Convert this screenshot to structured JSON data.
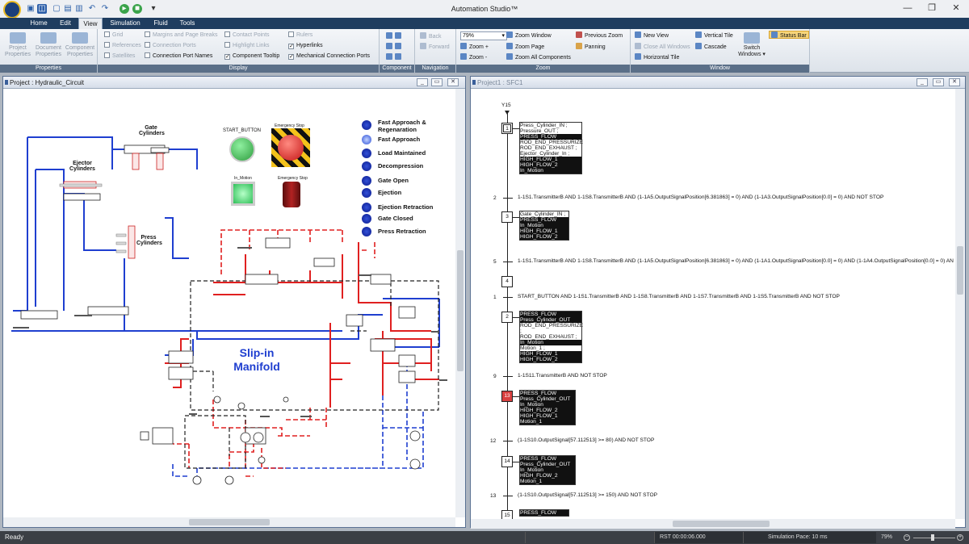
{
  "app": {
    "title": "Automation Studio™"
  },
  "qat": {
    "save_icon": "save-icon",
    "undo_icon": "undo-icon",
    "redo_icon": "redo-icon",
    "run_icon": "run-icon",
    "stop_icon": "stop-icon",
    "more": "▾"
  },
  "window_controls": {
    "minimize": "—",
    "restore": "❐",
    "close": "✕"
  },
  "tabs": [
    {
      "label": "Home"
    },
    {
      "label": "Edit"
    },
    {
      "label": "View"
    },
    {
      "label": "Simulation"
    },
    {
      "label": "Fluid"
    },
    {
      "label": "Tools"
    }
  ],
  "ribbon": {
    "properties": {
      "label": "Properties",
      "buttons": [
        {
          "label": "Project Properties"
        },
        {
          "label": "Document Properties"
        },
        {
          "label": "Component Properties"
        }
      ]
    },
    "display": {
      "label": "Display",
      "col1": [
        {
          "label": "Grid",
          "checked": false,
          "enabled": false
        },
        {
          "label": "References",
          "checked": false,
          "enabled": false
        },
        {
          "label": "Satellites",
          "checked": false,
          "enabled": false
        }
      ],
      "col2": [
        {
          "label": "Margins and Page Breaks",
          "checked": false,
          "enabled": false
        },
        {
          "label": "Connection Ports",
          "checked": false,
          "enabled": false
        },
        {
          "label": "Connection Port Names",
          "checked": false,
          "enabled": true
        }
      ],
      "col3": [
        {
          "label": "Contact Points",
          "checked": false,
          "enabled": false
        },
        {
          "label": "Highlight Links",
          "checked": false,
          "enabled": false
        },
        {
          "label": "Component Tooltip",
          "checked": true,
          "enabled": true
        }
      ],
      "col4": [
        {
          "label": "Rulers",
          "checked": false,
          "enabled": false
        },
        {
          "label": "Hyperlinks",
          "checked": true,
          "enabled": true
        },
        {
          "label": "Mechanical Connection Ports",
          "checked": true,
          "enabled": true
        }
      ]
    },
    "component": {
      "label": "Component"
    },
    "navigation": {
      "label": "Navigation",
      "back": "Back",
      "forward": "Forward"
    },
    "zoom": {
      "label": "Zoom",
      "value": "79%",
      "zoom_in": "Zoom +",
      "zoom_out": "Zoom -",
      "zoom_window": "Zoom Window",
      "zoom_page": "Zoom Page",
      "zoom_all": "Zoom All Components",
      "previous_zoom": "Previous Zoom",
      "panning": "Panning"
    },
    "window": {
      "label": "Window",
      "new_view": "New View",
      "close_all": "Close All Windows",
      "horizontal_tile": "Horizontal Tile",
      "vertical_tile": "Vertical Tile",
      "cascade": "Cascade",
      "switch_windows": "Switch Windows",
      "status_bar": "Status Bar"
    }
  },
  "left_window": {
    "title": "Project : Hydraulic_Circuit",
    "labels": {
      "gate_cylinders": "Gate Cylinders",
      "ejector_cylinders": "Ejector Cylinders",
      "press_cylinders": "Press Cylinders",
      "start_button": "START_BUTTON",
      "emergency_stop_small": "Emergency Stop",
      "in_motion": "In_Motion",
      "emergency_stop": "Emergency Stop",
      "slip_in_manifold": "Slip-in Manifold"
    },
    "indicators": [
      {
        "label": "Fast Approach & Regenaration"
      },
      {
        "label": "Fast Approach"
      },
      {
        "label": "Load Maintained"
      },
      {
        "label": "Decompression"
      },
      {
        "label": "Gate Open"
      },
      {
        "label": "Ejection"
      },
      {
        "label": "Ejection Retraction"
      },
      {
        "label": "Gate Closed"
      },
      {
        "label": "Press Retraction"
      }
    ]
  },
  "right_window": {
    "title": "Project1 : SFC1",
    "initial_label": "Y15",
    "steps": [
      {
        "num": "1",
        "actions": [
          {
            "text": "Press_Cylinder_IN ;",
            "dark": false
          },
          {
            "text": "Pressure_OUT ;",
            "dark": false
          },
          {
            "text": "PRESS_FLOW",
            "dark": true
          },
          {
            "text": "ROD_END_PRESSURIZE",
            "dark": false
          },
          {
            "text": "ROD_END_EXHAUST ;",
            "dark": false
          },
          {
            "text": "Ejector_Cylinder_In ;",
            "dark": false
          },
          {
            "text": "HIGH_FLOW_1",
            "dark": true
          },
          {
            "text": "HIGH_FLOW_2",
            "dark": true
          },
          {
            "text": "In_Motion",
            "dark": true
          }
        ]
      },
      {
        "num": "3",
        "actions": [
          {
            "text": "Gate_Cylinder_IN ;",
            "dark": false
          },
          {
            "text": "PRESS_FLOW",
            "dark": true
          },
          {
            "text": "In_Motion",
            "dark": true
          },
          {
            "text": "HIGH_FLOW_1",
            "dark": true
          },
          {
            "text": "HIGH_FLOW_2",
            "dark": true
          }
        ]
      },
      {
        "num": "4",
        "actions": []
      },
      {
        "num": "2",
        "actions": [
          {
            "text": "PRESS_FLOW",
            "dark": true
          },
          {
            "text": "Press_Cylinder_OUT",
            "dark": true
          },
          {
            "text": "ROD_END_PRESSURIZE ;",
            "dark": false
          },
          {
            "text": "ROD_END_EXHAUST ;",
            "dark": false
          },
          {
            "text": "In_Motion",
            "dark": true
          },
          {
            "text": "Motion_1 ;",
            "dark": false
          },
          {
            "text": "HIGH_FLOW_1",
            "dark": true
          },
          {
            "text": "HIGH_FLOW_2",
            "dark": true
          }
        ]
      },
      {
        "num": "13",
        "actions": [
          {
            "text": "PRESS_FLOW",
            "dark": true
          },
          {
            "text": "Press_Cylinder_OUT",
            "dark": true
          },
          {
            "text": "In_Motion",
            "dark": true
          },
          {
            "text": "HIGH_FLOW_2",
            "dark": true
          },
          {
            "text": "HIGH_FLOW_1",
            "dark": true
          },
          {
            "text": "Motion_1",
            "dark": true
          }
        ]
      },
      {
        "num": "14",
        "actions": [
          {
            "text": "PRESS_FLOW",
            "dark": true
          },
          {
            "text": "Press_Cylinder_OUT",
            "dark": true
          },
          {
            "text": "In_Motion",
            "dark": true
          },
          {
            "text": "HIGH_FLOW_2",
            "dark": true
          },
          {
            "text": "Motion_1",
            "dark": true
          }
        ]
      },
      {
        "num": "15",
        "actions": [
          {
            "text": "PRESS_FLOW",
            "dark": true
          }
        ]
      }
    ],
    "transitions": [
      {
        "num": "2",
        "text": "1-1S1.TransmitterB AND 1-1S8.TransmitterB AND (1-1A5.OutputSignalPosition[6.381863] = 0) AND (1-1A3.OutputSignalPosition[0.0] = 0)  AND  NOT  STOP"
      },
      {
        "num": "5",
        "text": "1-1S1.TransmitterB AND 1-1S8.TransmitterB AND (1-1A5.OutputSignalPosition[6.381863] = 0) AND (1-1A1.OutputSignalPosition[0.0] = 0) AND (1-1A4.OutputSignalPosition[0.0] = 0) AN"
      },
      {
        "num": "1",
        "text": "START_BUTTON  AND  1-1S1.TransmitterB AND 1-1S8.TransmitterB AND 1-1S7.TransmitterB  AND  1-1S5.TransmitterB   AND NOT STOP"
      },
      {
        "num": "9",
        "text": "1-1S11.TransmitterB AND NOT  STOP"
      },
      {
        "num": "12",
        "text": "(1-1S10.OutputSignal[57.112513] >= 80)  AND  NOT  STOP"
      },
      {
        "num": "13",
        "text": "(1-1S10.OutputSignal[57.112513] >= 150)  AND  NOT  STOP"
      }
    ]
  },
  "status": {
    "ready": "Ready",
    "rst": "RST 00:00:06.000",
    "pace": "Simulation Pace: 10 ms",
    "zoom": "79%"
  },
  "colors": {
    "pressure": "#e02020",
    "tank": "#1f3fd0",
    "pilot": "#222222",
    "active_step": "#d84040"
  }
}
